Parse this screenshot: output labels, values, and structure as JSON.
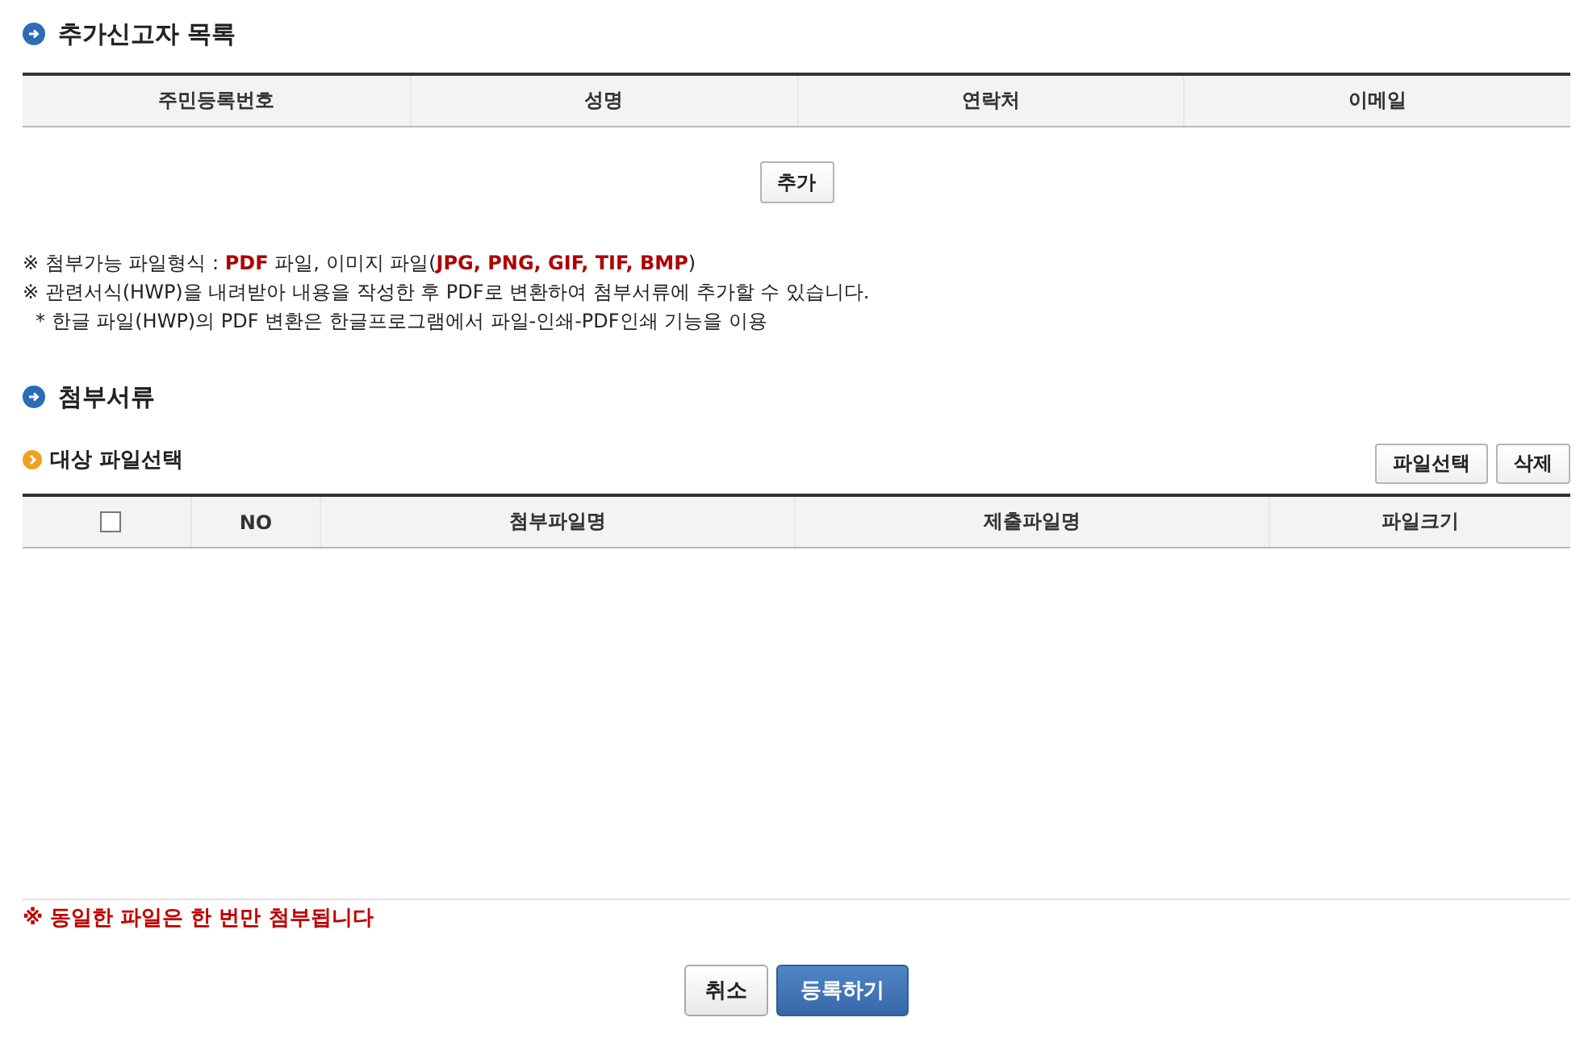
{
  "reporters": {
    "title": "추가신고자 목록",
    "columns": [
      "주민등록번호",
      "성명",
      "연락처",
      "이메일"
    ],
    "add_button": "추가"
  },
  "notes": [
    {
      "kind": "mark",
      "text": "※ 첨부가능 파일형식 : **PDF** 파일, 이미지 파일(**JPG, PNG, GIF, TIF, BMP**)"
    },
    {
      "kind": "mark",
      "text": "※ 관련서식(HWP)을 내려받아 내용을 작성한 후 PDF로 변환하여 첨부서류에 추가할 수 있습니다."
    },
    {
      "kind": "sub",
      "text": "* 한글 파일(HWP)의 PDF 변환은 한글프로그램에서 파일-인쇄-PDF인쇄 기능을 이용"
    }
  ],
  "attachments": {
    "title": "첨부서류",
    "subtitle": "대상 파일선택",
    "buttons": [
      "파일선택",
      "삭제"
    ],
    "columns": [
      {
        "kind": "checkbox",
        "checked": false
      },
      {
        "kind": "text",
        "label": "NO"
      },
      {
        "kind": "text",
        "label": "첨부파일명"
      },
      {
        "kind": "text",
        "label": "제출파일명"
      },
      {
        "kind": "text",
        "label": "파일크기"
      }
    ],
    "warning": "※ 동일한 파일은 한 번만 첨부됩니다"
  },
  "actions": [
    {
      "kind": "secondary",
      "label": "취소"
    },
    {
      "kind": "primary",
      "label": "등록하기"
    }
  ]
}
